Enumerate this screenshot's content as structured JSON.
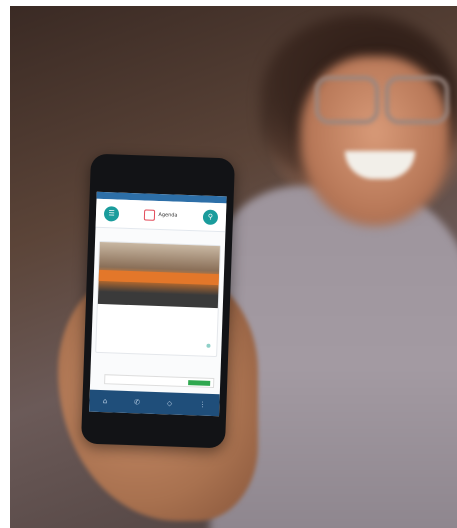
{
  "app": {
    "logo_text": "Agenda"
  },
  "icons": {
    "menu": "menu-icon",
    "search": "search-icon",
    "nav_home": "home-icon",
    "nav_phone": "phone-icon",
    "nav_chat": "chat-icon",
    "nav_more": "more-icon"
  },
  "colors": {
    "accent": "#1a9c9c",
    "brand": "#e24a59",
    "statusbar": "#2d6fa8",
    "bottomnav": "#1f4e7a"
  }
}
